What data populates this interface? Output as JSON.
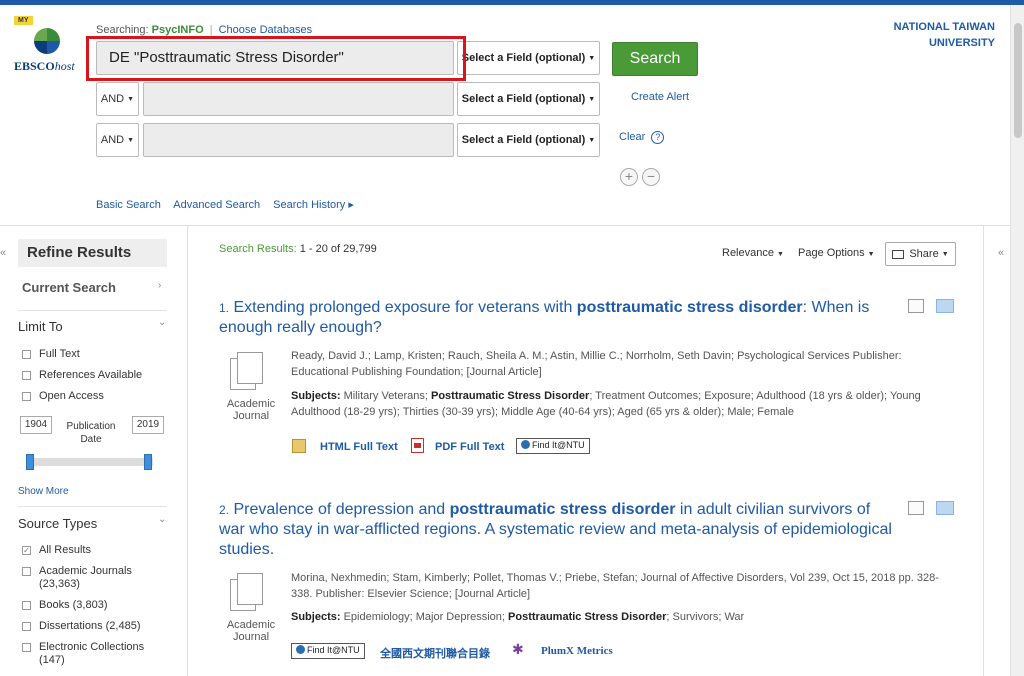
{
  "header": {
    "searching_label": "Searching:",
    "database": "PsycINFO",
    "choose_databases": "Choose Databases",
    "logo_badge": "MY",
    "logo_text_bold": "EBSCO",
    "logo_text_italic": "host",
    "institution_line1": "NATIONAL TAIWAN",
    "institution_line2": "UNIVERSITY"
  },
  "search": {
    "row1_term": "DE \"Posttraumatic Stress Disorder\"",
    "field_placeholder": "Select a Field (optional)",
    "operator": "AND",
    "search_button": "Search",
    "create_alert": "Create Alert",
    "clear": "Clear",
    "help": "?",
    "add": "+",
    "remove": "−"
  },
  "sublinks": {
    "basic": "Basic Search",
    "advanced": "Advanced Search",
    "history": "Search History ▸"
  },
  "sidebar": {
    "collapse": "«",
    "refine_title": "Refine Results",
    "current_search": "Current Search",
    "limit_to": "Limit To",
    "limits": [
      "Full Text",
      "References Available",
      "Open Access"
    ],
    "year_from": "1904",
    "year_to": "2019",
    "publication_date": "Publication Date",
    "show_more": "Show More",
    "source_types_title": "Source Types",
    "source_types": [
      {
        "label": "All Results",
        "checked": true
      },
      {
        "label": "Academic Journals (23,363)",
        "checked": false
      },
      {
        "label": "Books (3,803)",
        "checked": false
      },
      {
        "label": "Dissertations (2,485)",
        "checked": false
      },
      {
        "label": "Electronic Collections (147)",
        "checked": false
      }
    ]
  },
  "results_bar": {
    "label": "Search Results:",
    "range": "1 - 20 of 29,799",
    "relevance": "Relevance",
    "page_options": "Page Options",
    "share": "Share",
    "collapse_right": "«"
  },
  "results": [
    {
      "number": "1.",
      "title_pre": "Extending prolonged exposure for veterans with ",
      "title_bold": "posttraumatic stress disorder",
      "title_post": ": When is enough really enough?",
      "pub_type": "Academic Journal",
      "meta": "Ready, David J.; Lamp, Kristen; Rauch, Sheila A. M.; Astin, Millie C.; Norrholm, Seth Davin; Psychological Services Publisher: Educational Publishing Foundation; [Journal Article]",
      "subjects_label": "Subjects:",
      "subjects_pre": " Military Veterans; ",
      "subjects_bold": "Posttraumatic Stress Disorder",
      "subjects_post": "; Treatment Outcomes; Exposure; Adulthood (18 yrs & older); Young Adulthood (18-29 yrs); Thirties (30-39 yrs); Middle Age (40-64 yrs); Aged (65 yrs & older); Male; Female",
      "html_full_text": "HTML Full Text",
      "pdf_full_text": "PDF Full Text",
      "find_it": "Find It@NTU"
    },
    {
      "number": "2.",
      "title_pre": "Prevalence of depression and ",
      "title_bold": "posttraumatic stress disorder",
      "title_post": " in adult civilian survivors of war who stay in war-afflicted regions. A systematic review and meta-analysis of epidemiological studies.",
      "pub_type": "Academic Journal",
      "meta": "Morina, Nexhmedin; Stam, Kimberly; Pollet, Thomas V.; Priebe, Stefan; Journal of Affective Disorders, Vol 239, Oct 15, 2018 pp. 328-338. Publisher: Elsevier Science; [Journal Article]",
      "subjects_label": "Subjects:",
      "subjects_pre": " Epidemiology; Major Depression; ",
      "subjects_bold": "Posttraumatic Stress Disorder",
      "subjects_post": "; Survivors; War",
      "find_it": "Find It@NTU",
      "union_catalog": "全國西文期刊聯合目錄",
      "plumx": "PlumX Metrics"
    }
  ]
}
